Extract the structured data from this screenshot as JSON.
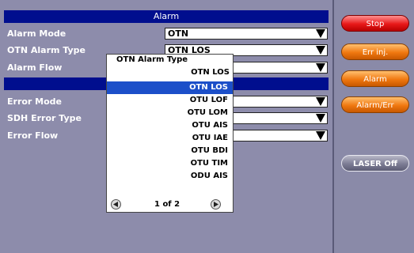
{
  "alarm_section": {
    "title": "Alarm",
    "rows": [
      {
        "label": "Alarm Mode",
        "value": "OTN"
      },
      {
        "label": "OTN Alarm Type",
        "value": "OTN LOS"
      },
      {
        "label": "Alarm Flow",
        "value": ""
      }
    ]
  },
  "error_section": {
    "title": "",
    "rows": [
      {
        "label": "Error Mode",
        "value": ""
      },
      {
        "label": "SDH Error Type",
        "value": ""
      },
      {
        "label": "Error Flow",
        "value": ""
      }
    ]
  },
  "popup": {
    "title": "OTN Alarm Type",
    "current": "OTN LOS",
    "items": [
      "OTN LOS",
      "OTU LOF",
      "OTU LOM",
      "OTU AIS",
      "OTU IAE",
      "OTU BDI",
      "OTU TIM",
      "ODU AIS"
    ],
    "selected_index": 0,
    "pager": "1 of 2"
  },
  "side_buttons": {
    "stop": "Stop",
    "err_inj": "Err inj.",
    "alarm": "Alarm",
    "alarm_err": "Alarm/Err",
    "laser_off": "LASER Off"
  },
  "icons": {
    "dropdown": "triangle-down-icon",
    "prev": "arrow-left-icon",
    "next": "arrow-right-icon"
  },
  "colors": {
    "header": "#000e8e",
    "background": "#8d8cab",
    "selection": "#1c4fc9",
    "stop_button": "#e81818",
    "action_button": "#f07810"
  }
}
